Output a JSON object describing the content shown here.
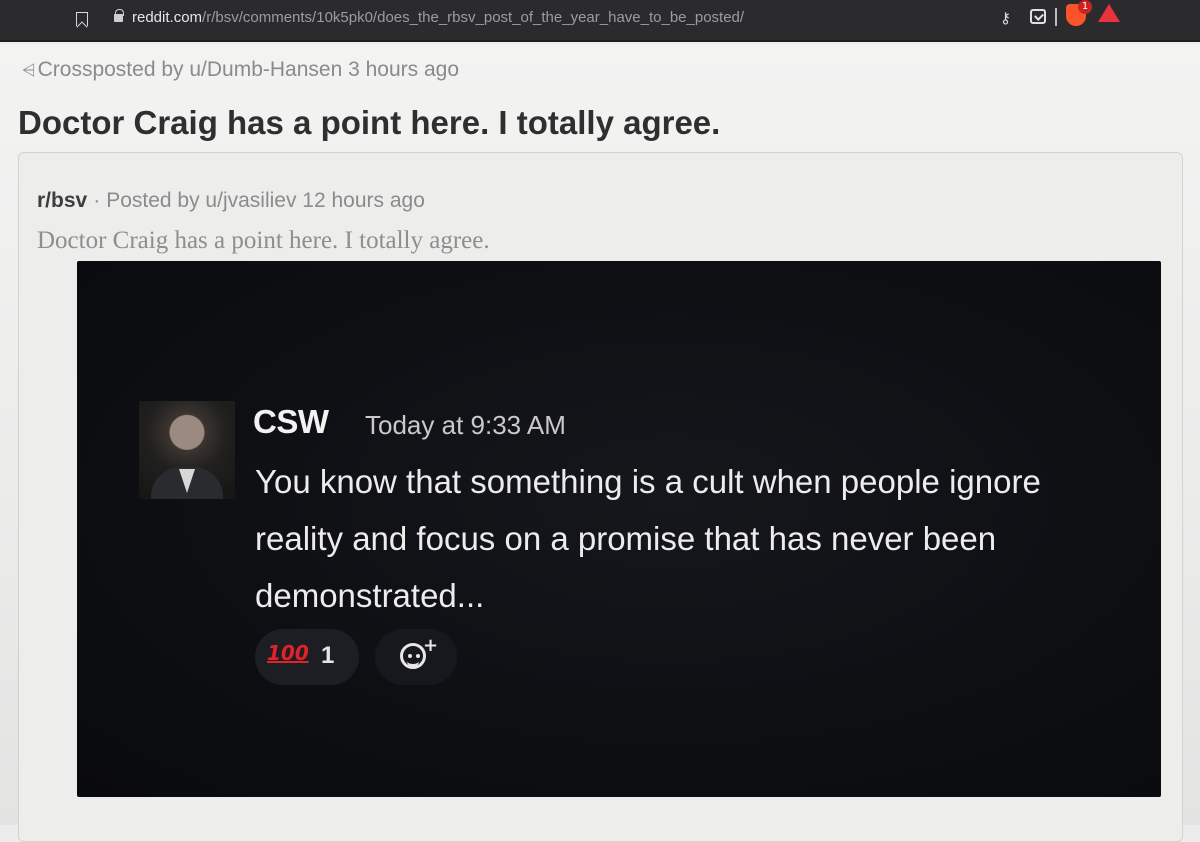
{
  "browser": {
    "url_host": "reddit.com",
    "url_path": "/r/bsv/comments/10k5pk0/does_the_rbsv_post_of_the_year_have_to_be_posted/",
    "brave_badge": "1"
  },
  "crosspost": {
    "label": "Crossposted by u/Dumb-Hansen 3 hours ago"
  },
  "post": {
    "title": "Doctor Craig has a point here. I totally agree."
  },
  "embed": {
    "subreddit": "r/bsv",
    "separator": "·",
    "posted_by": "Posted by u/jvasiliev 12 hours ago",
    "title": "Doctor Craig has a point here. I totally agree."
  },
  "chat": {
    "author": "CSW",
    "time": "Today at 9:33 AM",
    "message": "You know that something is a cult when people ignore reality and focus on a promise that has never been demonstrated...",
    "reaction": {
      "emoji": "100",
      "count": "1"
    },
    "add_reaction_plus": "+"
  },
  "colors": {
    "browser_bar": "#2b2b2e",
    "page_bg": "#ececec",
    "chat_bg": "#0d0f13",
    "reaction_red": "#e2222a"
  },
  "icons": [
    "bookmark-icon",
    "lock-icon",
    "key-icon",
    "download-icon",
    "brave-icon",
    "rewards-icon",
    "crosspost-icon",
    "add-reaction-icon"
  ]
}
